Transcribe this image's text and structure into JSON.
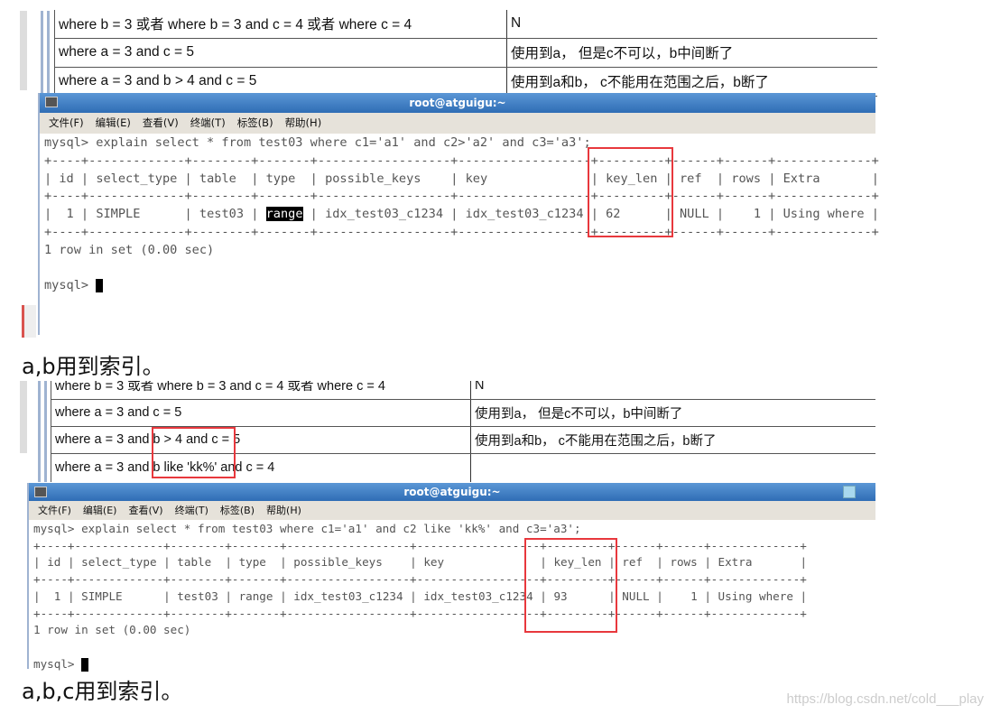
{
  "block1": {
    "table_rows": [
      {
        "condition": "where b = 3 或者 where b = 3 and c = 4  或者 where c = 4",
        "note": "N"
      },
      {
        "condition": "where a = 3 and c = 5",
        "note": "使用到a， 但是c不可以，b中间断了"
      },
      {
        "condition": "where a = 3 and b > 4 and c = 5",
        "note": "使用到a和b， c不能用在范围之后，b断了"
      }
    ],
    "terminal": {
      "title": "root@atguigu:~",
      "menu": [
        "文件(F)",
        "编辑(E)",
        "查看(V)",
        "终端(T)",
        "标签(B)",
        "帮助(H)"
      ],
      "command": "mysql> explain select * from test03 where c1='a1' and c2>'a2' and c3='a3';",
      "columns": [
        "id",
        "select_type",
        "table",
        "type",
        "possible_keys",
        "key",
        "key_len",
        "ref",
        "rows",
        "Extra"
      ],
      "row": [
        "1",
        "SIMPLE",
        "test03",
        "range",
        "idx_test03_c1234",
        "idx_test03_c1234",
        "62",
        "NULL",
        "1",
        "Using where"
      ],
      "result": "1 row in set (0.00 sec)",
      "prompt": "mysql> "
    },
    "caption": "a,b用到索引。"
  },
  "block2": {
    "table_rows": [
      {
        "condition": "where b = 3 或者 where b = 3 and c = 4  或者 where c = 4",
        "note": "N"
      },
      {
        "condition": "where a = 3 and c = 5",
        "note": "使用到a， 但是c不可以，b中间断了"
      },
      {
        "condition": "where a = 3 and b > 4 and c = 5",
        "note": "使用到a和b， c不能用在范围之后，b断了"
      },
      {
        "condition": "where a = 3 and b like 'kk%' and c = 4",
        "note": ""
      }
    ],
    "terminal": {
      "title": "root@atguigu:~",
      "menu": [
        "文件(F)",
        "编辑(E)",
        "查看(V)",
        "终端(T)",
        "标签(B)",
        "帮助(H)"
      ],
      "command": "mysql> explain select * from test03 where c1='a1' and c2 like 'kk%' and c3='a3';",
      "columns": [
        "id",
        "select_type",
        "table",
        "type",
        "possible_keys",
        "key",
        "key_len",
        "ref",
        "rows",
        "Extra"
      ],
      "row": [
        "1",
        "SIMPLE",
        "test03",
        "range",
        "idx_test03_c1234",
        "idx_test03_c1234",
        "93",
        "NULL",
        "1",
        "Using where"
      ],
      "result": "1 row in set (0.00 sec)",
      "prompt": "mysql> "
    },
    "caption": "a,b,c用到索引。"
  },
  "watermark": "https://blog.csdn.net/cold___play",
  "colors": {
    "highlight_box": "#e8383d",
    "titlebar": "#3a78c0"
  }
}
